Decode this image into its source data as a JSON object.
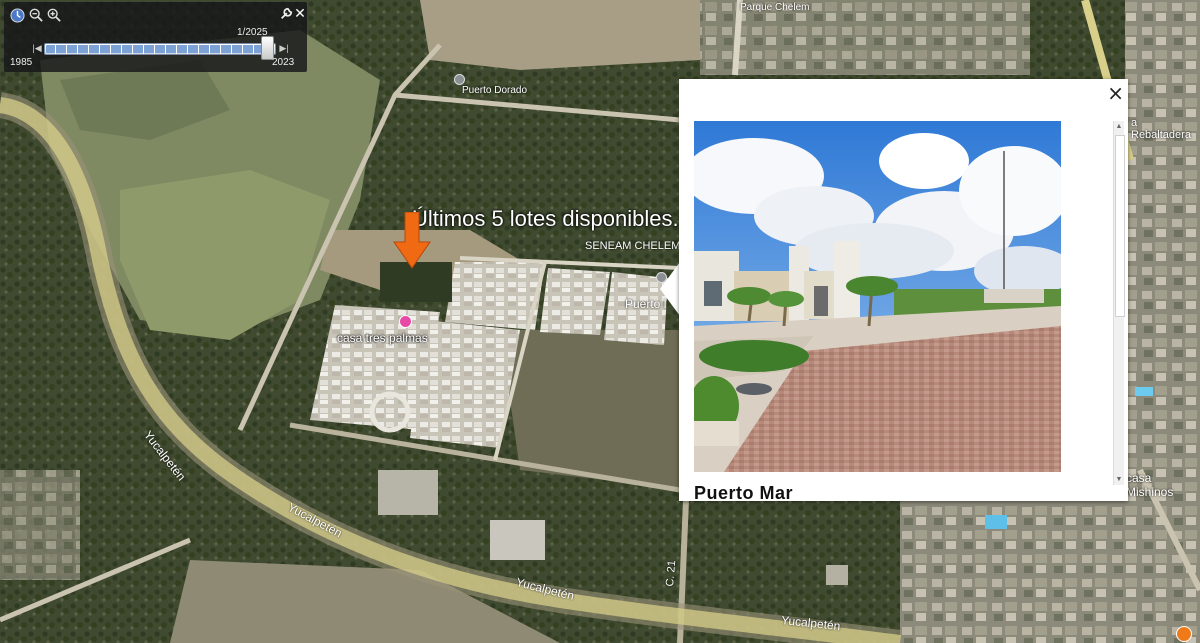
{
  "timeline": {
    "current_date": "1/2025",
    "start_year": "1985",
    "end_year": "2023",
    "position": 0.98
  },
  "map": {
    "announcement": "Últimos 5 lotes disponibles.",
    "labels": {
      "puerto_dorado": "Puerto Dorado",
      "seneam": "SENEAM CHELEM",
      "puerto_short": "Puerto l",
      "casa_tres_palmas": "casa tres palmas",
      "casa_mishinos": "casa Mishinos",
      "la_rebaltadera": "a Rebaltadera",
      "parque": "Parque Chelem",
      "c21": "C. 21",
      "yucalpeten_1": "Yucalpetén",
      "yucalpeten_2": "Yucalpetén",
      "yucalpeten_3": "Yucalpetén",
      "yucalpeten_4": "Yucalpetén"
    },
    "colors": {
      "road": "#d8cf8a",
      "arrow": "#f06a14",
      "marker_pink": "#e64aa6",
      "marker_gray": "#8a8f93"
    }
  },
  "popup": {
    "close_label": "×",
    "title_partial": "Puerto Mar"
  }
}
